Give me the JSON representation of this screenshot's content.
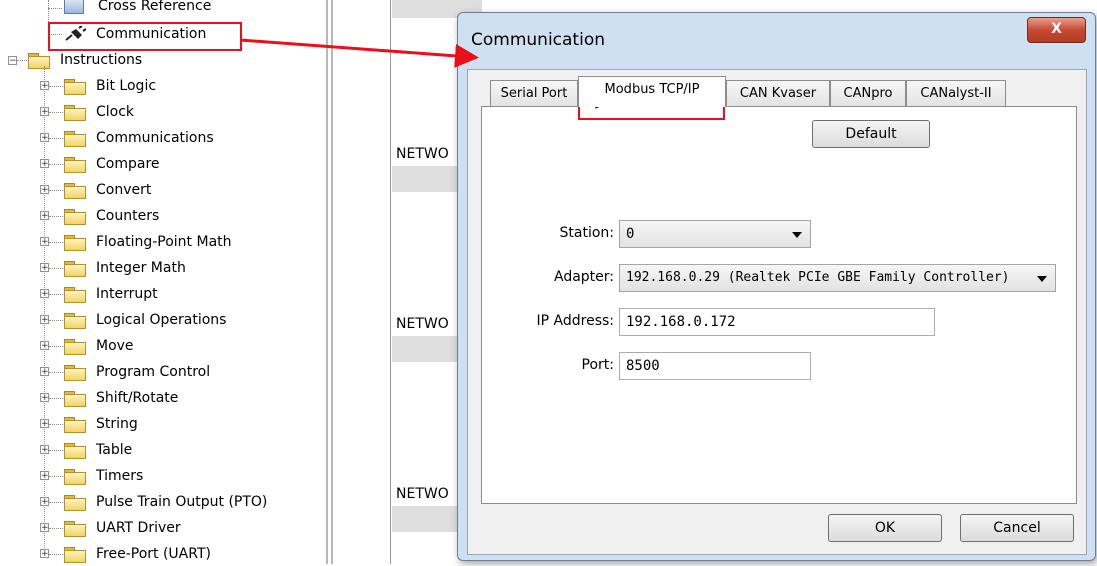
{
  "tree": {
    "cross_reference": "Cross Reference",
    "communication": "Communication",
    "instructions": "Instructions",
    "items": [
      "Bit Logic",
      "Clock",
      "Communications",
      "Compare",
      "Convert",
      "Counters",
      "Floating-Point Math",
      "Integer Math",
      "Interrupt",
      "Logical Operations",
      "Move",
      "Program Control",
      "Shift/Rotate",
      "String",
      "Table",
      "Timers",
      "Pulse Train Output (PTO)",
      "UART Driver",
      "Free-Port (UART)"
    ]
  },
  "work": {
    "network_label": "NETWO"
  },
  "dialog": {
    "title": "Communication",
    "close_label": "X",
    "tabs": [
      "Serial Port",
      "Modbus TCP/IP",
      "CAN Kvaser",
      "CANpro",
      "CANalyst-II"
    ],
    "active_tab": "Modbus TCP/IP",
    "default_label": "Default",
    "station_label": "Station:",
    "station_value": "0",
    "adapter_label": "Adapter:",
    "adapter_value": "192.168.0.29 (Realtek PCIe GBE Family Controller)",
    "ip_label": "IP Address:",
    "ip_value": "192.168.0.172",
    "port_label": "Port:",
    "port_value": "8500",
    "ok_label": "OK",
    "cancel_label": "Cancel"
  },
  "colors": {
    "highlight": "#e8101b",
    "dialog_frame": "#cfe0f2",
    "close_button": "#c74a32"
  }
}
